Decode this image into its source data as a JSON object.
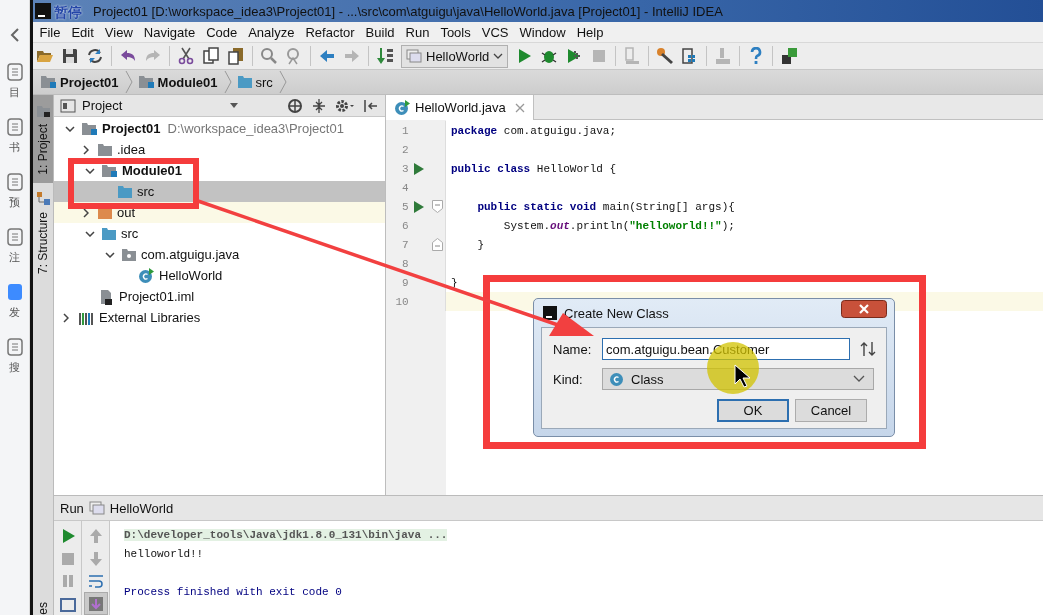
{
  "desktop_sidebar": {
    "items": [
      {
        "label": "目"
      },
      {
        "label": "书"
      },
      {
        "label": "预"
      },
      {
        "label": "注"
      },
      {
        "label": "发"
      },
      {
        "label": "搜"
      }
    ]
  },
  "recorder_overlay": {
    "label": "暂停"
  },
  "window": {
    "title": "Project01 [D:\\workspace_idea3\\Project01] - ...\\src\\com\\atguigu\\java\\HelloWorld.java [Project01] - IntelliJ IDEA"
  },
  "menu": [
    "File",
    "Edit",
    "View",
    "Navigate",
    "Code",
    "Analyze",
    "Refactor",
    "Build",
    "Run",
    "Tools",
    "VCS",
    "Window",
    "Help"
  ],
  "toolbar": [
    {
      "kind": "open",
      "disabled": false
    },
    {
      "kind": "save",
      "disabled": false
    },
    {
      "kind": "sync",
      "disabled": false
    },
    {
      "kind": "separator"
    },
    {
      "kind": "undo",
      "disabled": false
    },
    {
      "kind": "redo",
      "disabled": true
    },
    {
      "kind": "separator"
    },
    {
      "kind": "cut",
      "disabled": false
    },
    {
      "kind": "copy",
      "disabled": false
    },
    {
      "kind": "paste",
      "disabled": false
    },
    {
      "kind": "separator"
    },
    {
      "kind": "find",
      "disabled": false
    },
    {
      "kind": "replace",
      "disabled": false
    },
    {
      "kind": "separator"
    },
    {
      "kind": "back",
      "disabled": false
    },
    {
      "kind": "forward",
      "disabled": true
    },
    {
      "kind": "separator"
    },
    {
      "kind": "make",
      "disabled": false
    },
    {
      "kind": "config",
      "label": "HelloWorld"
    },
    {
      "kind": "run",
      "disabled": false
    },
    {
      "kind": "debug",
      "disabled": false
    },
    {
      "kind": "coverage",
      "disabled": false
    },
    {
      "kind": "stop",
      "disabled": true
    },
    {
      "kind": "separator"
    },
    {
      "kind": "structure",
      "disabled": true
    },
    {
      "kind": "separator"
    },
    {
      "kind": "settings",
      "disabled": false
    },
    {
      "kind": "modules",
      "disabled": false
    },
    {
      "kind": "separator"
    },
    {
      "kind": "sdk",
      "disabled": true
    },
    {
      "kind": "separator"
    },
    {
      "kind": "help",
      "disabled": false
    },
    {
      "kind": "separator"
    },
    {
      "kind": "plugin",
      "disabled": false
    }
  ],
  "breadcrumbs": [
    {
      "label": "Project01",
      "kind": "module"
    },
    {
      "label": "Module01",
      "kind": "module"
    },
    {
      "label": "src",
      "kind": "source"
    }
  ],
  "tool_strip": [
    {
      "label": "1: Project",
      "kind": "project",
      "selected": true
    },
    {
      "label": "7: Structure",
      "kind": "structure",
      "selected": false
    }
  ],
  "lower_tool_strip": [
    {
      "label": "es"
    }
  ],
  "project_panel": {
    "title": "Project",
    "tree": [
      {
        "label": "Project01",
        "path": "D:\\workspace_idea3\\Project01",
        "kind": "module",
        "expanded": true,
        "selected": false,
        "highlighted": false,
        "children": [
          {
            "label": ".idea",
            "kind": "folder",
            "expanded": false,
            "selected": false,
            "highlighted": false
          },
          {
            "label": "Module01",
            "kind": "module",
            "expanded": true,
            "selected": false,
            "highlighted": false,
            "children": [
              {
                "label": "src",
                "kind": "source",
                "selected": true,
                "highlighted": false
              }
            ]
          },
          {
            "label": "out",
            "kind": "excluded",
            "expanded": false,
            "selected": false,
            "highlighted": true
          },
          {
            "label": "src",
            "kind": "source",
            "expanded": true,
            "selected": false,
            "highlighted": false,
            "children": [
              {
                "label": "com.atguigu.java",
                "kind": "package",
                "expanded": true,
                "selected": false,
                "highlighted": false,
                "children": [
                  {
                    "label": "HelloWorld",
                    "kind": "class",
                    "selected": false,
                    "highlighted": false
                  }
                ]
              }
            ]
          },
          {
            "label": "Project01.iml",
            "kind": "iml",
            "selected": false,
            "highlighted": false
          }
        ]
      },
      {
        "label": "External Libraries",
        "kind": "libraries",
        "expanded": false,
        "selected": false,
        "highlighted": false
      }
    ]
  },
  "editor": {
    "tabs": [
      {
        "label": "HelloWorld.java",
        "selected": true
      }
    ],
    "lines": [
      {
        "number": "1",
        "current": false,
        "code": [
          {
            "text": "package",
            "kind": "keyword"
          },
          {
            "text": " com.atguigu.java;",
            "kind": "plain"
          }
        ]
      },
      {
        "number": "2",
        "current": false
      },
      {
        "number": "3",
        "run_marker": true,
        "current": false,
        "code": [
          {
            "text": "public class",
            "kind": "keyword"
          },
          {
            "text": " HelloWorld {",
            "kind": "plain"
          }
        ]
      },
      {
        "number": "4",
        "current": false
      },
      {
        "number": "5",
        "run_marker": true,
        "fold_start": true,
        "current": false,
        "code": [
          {
            "text": "    public static void",
            "kind": "keyword"
          },
          {
            "text": " main(String[] args){",
            "kind": "plain"
          }
        ]
      },
      {
        "number": "6",
        "current": false,
        "code": [
          {
            "text": "        System.",
            "kind": "plain"
          },
          {
            "text": "out",
            "kind": "static"
          },
          {
            "text": ".println(",
            "kind": "plain"
          },
          {
            "text": "\"helloworld!!\"",
            "kind": "string"
          },
          {
            "text": ");",
            "kind": "plain"
          }
        ]
      },
      {
        "number": "7",
        "fold_end": true,
        "current": false,
        "code": [
          {
            "text": "    }",
            "kind": "plain"
          }
        ]
      },
      {
        "number": "8",
        "current": false
      },
      {
        "number": "9",
        "current": false,
        "code": [
          {
            "text": "}",
            "kind": "plain"
          }
        ]
      },
      {
        "number": "10",
        "current": true
      }
    ]
  },
  "dialog": {
    "title": "Create New Class",
    "name_label": "Name:",
    "name_value": "com.atguigu.bean.Customer",
    "kind_label": "Kind:",
    "kind_value": "Class",
    "buttons": [
      {
        "label": "OK",
        "default": true
      },
      {
        "label": "Cancel",
        "default": false
      }
    ]
  },
  "run_panel": {
    "title": "Run",
    "config": "HelloWorld",
    "left_tools": [
      {
        "kind": "rerun",
        "disabled": false
      },
      {
        "kind": "stop",
        "disabled": true
      },
      {
        "kind": "pause",
        "disabled": true
      },
      {
        "kind": "layout",
        "disabled": false
      }
    ],
    "right_tools": [
      {
        "kind": "up",
        "disabled": true,
        "on": false
      },
      {
        "kind": "down",
        "disabled": true,
        "on": false
      },
      {
        "kind": "wrap",
        "disabled": false,
        "on": false
      },
      {
        "kind": "scroll",
        "disabled": false,
        "on": true
      }
    ],
    "output": [
      {
        "text": "D:\\developer_tools\\Java\\jdk1.8.0_131\\bin\\java ...",
        "kind": "command"
      },
      {
        "text": "helloworld!!",
        "kind": "stdout"
      },
      {
        "kind": "blank"
      },
      {
        "text": "Process finished with exit code 0",
        "kind": "system"
      }
    ]
  }
}
